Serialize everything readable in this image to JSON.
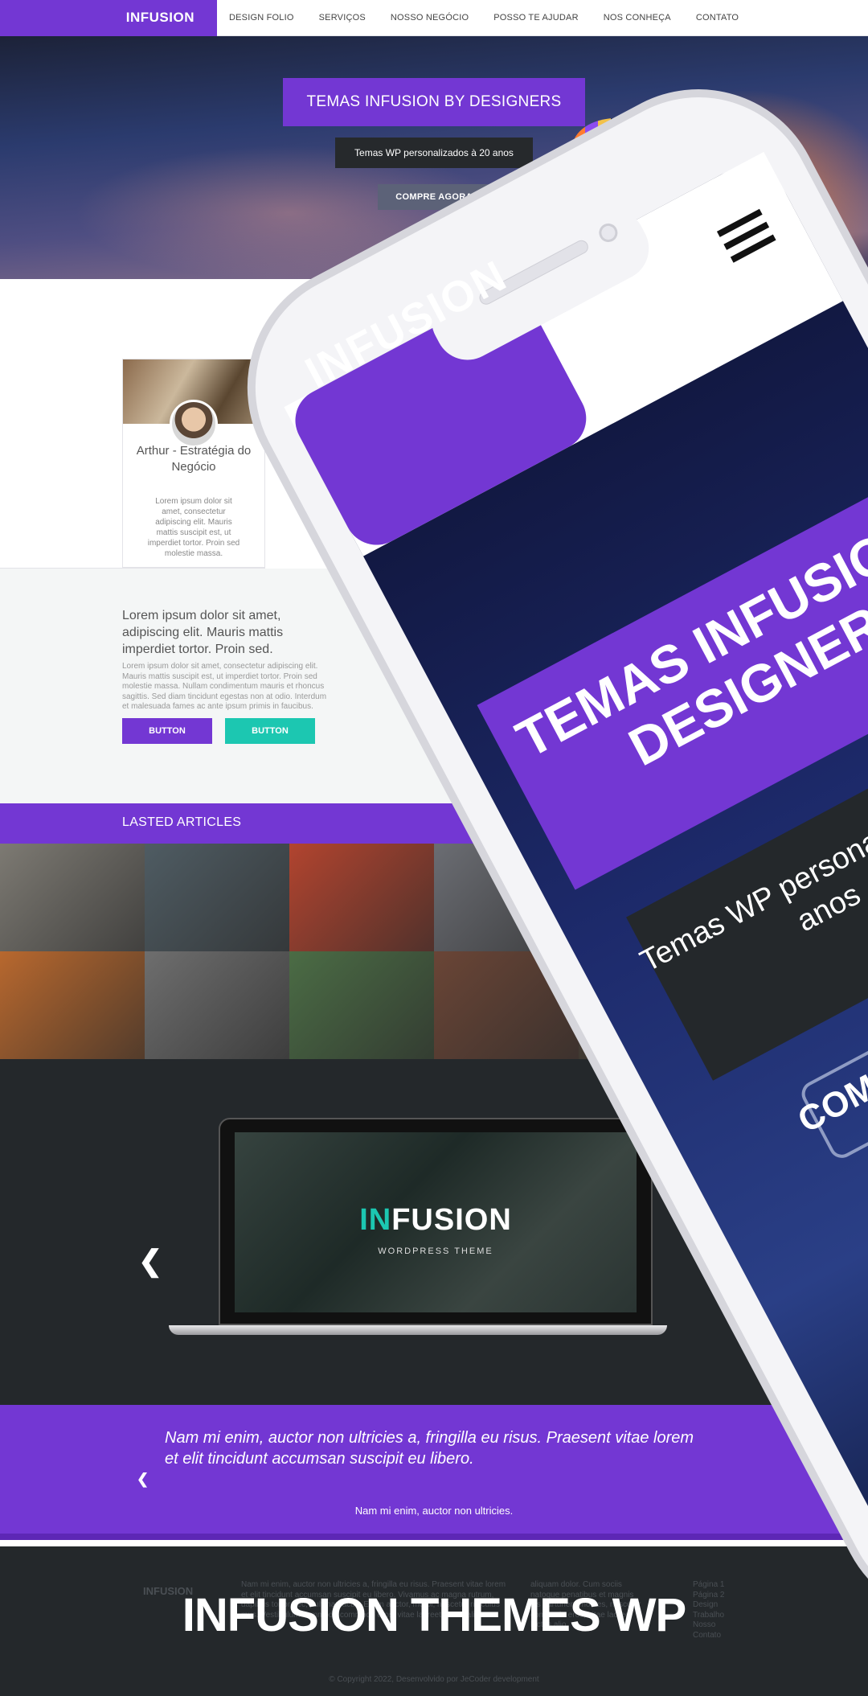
{
  "nav": {
    "logo": "INFUSION",
    "items": [
      "DESIGN FOLIO",
      "SERVIÇOS",
      "NOSSO NEGÓCIO",
      "POSSO TE AJUDAR",
      "NOS CONHEÇA",
      "CONTATO"
    ]
  },
  "hero": {
    "title": "TEMAS INFUSION BY DESIGNERS",
    "subtitle": "Temas WP personalizados à 20 anos",
    "button": "COMPRE AGORA"
  },
  "profile": {
    "name": "Arthur - Estratégia do Negócio",
    "text": "Lorem ipsum dolor sit amet, consectetur adipiscing elit. Mauris mattis suscipit est, ut imperdiet tortor. Proin sed molestie massa."
  },
  "intro": {
    "lead": "Lorem ipsum dolor sit amet, adipiscing elit. Mauris mattis imperdiet tortor. Proin sed.",
    "body": "Lorem ipsum dolor sit amet, consectetur adipiscing elit. Mauris mattis suscipit est, ut imperdiet tortor. Proin sed molestie massa. Nullam condimentum mauris et rhoncus sagittis. Sed diam tincidunt egestas non at odio. Interdum et malesuada fames ac ante ipsum primis in faucibus.",
    "button1": "BUTTON",
    "button2": "BUTTON"
  },
  "articles": {
    "title": "LASTED ARTICLES",
    "tiles": [
      {
        "name": "chain-photo",
        "color": "#7d7a73"
      },
      {
        "name": "waves-photo",
        "color": "#4f5c63"
      },
      {
        "name": "red-wall-photo",
        "color": "#b2442f"
      },
      {
        "name": "photo-4",
        "color": "#6b6d73"
      },
      {
        "name": "photo-5",
        "color": "#5a6470"
      },
      {
        "name": "photo-6",
        "color": "#3e4750"
      },
      {
        "name": "photo-7",
        "color": "#5b5560"
      },
      {
        "name": "photo-8",
        "color": "#4a4e57"
      },
      {
        "name": "fox-photo",
        "color": "#b8682e"
      },
      {
        "name": "hands-photo",
        "color": "#6e6e6e"
      },
      {
        "name": "forest-photo",
        "color": "#4b6c45"
      },
      {
        "name": "desk-photo",
        "color": "#6a4536"
      },
      {
        "name": "photo-13",
        "color": "#4a4036"
      },
      {
        "name": "photo-14",
        "color": "#3f4246"
      },
      {
        "name": "photo-15",
        "color": "#55504b"
      },
      {
        "name": "photo-16",
        "color": "#383c42"
      }
    ]
  },
  "slider": {
    "title_accent": "IN",
    "title_rest": "FUSION",
    "subtitle": "WORDPRESS THEME"
  },
  "testimonial": {
    "quote": "Nam mi enim, auctor non ultricies a, fringilla eu risus. Praesent vitae lorem et elit tincidunt accumsan suscipit eu libero.",
    "author": "Nam mi enim, auctor non ultricies."
  },
  "footer": {
    "logo": "INFUSION",
    "col1": "Nam mi enim, auctor non ultricies a, fringilla eu risus. Praesent vitae lorem et elit tincidunt accumsan suscipit eu libero. Vivamus ac magna rutrum, dapibus tortor nec, pulvinar lacus. Etiam auctor, morbi, nascetur ridiculus mus. Vestibulum commodo commodo eros, vitae laoreet lectus alio.",
    "col2": "aliquam dolor. Cum sociis natoque penatibus et magnis dis parturient montes, nascetur commodo eros, vitae laoreet lectus alio.",
    "links": [
      "Página 1",
      "Página 2",
      "Design",
      "Trabalho",
      "Nosso",
      "Contato"
    ],
    "copyright": "© Copyright 2022, Desenvolvido por JeCoder development",
    "caption": "INFUSION THEMES WP"
  },
  "phone": {
    "logo": "INFUSION",
    "title_line1": "TEMAS INFUSION BY",
    "title_line2": "DESIGNERS",
    "subtitle_line1": "Temas WP personaliza",
    "subtitle_line2": "anos",
    "button": "COMPR"
  },
  "colors": {
    "accent": "#7337d3",
    "teal": "#1cc7b1",
    "dark": "#24282b"
  }
}
